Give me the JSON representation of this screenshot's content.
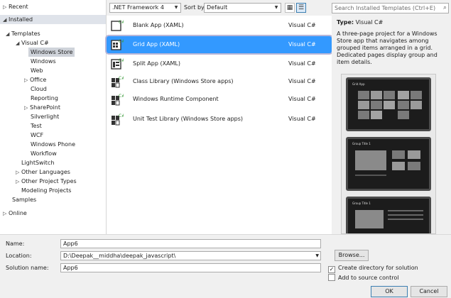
{
  "tree": {
    "recent": "Recent",
    "installed": "Installed",
    "templates": "Templates",
    "visual_csharp": "Visual C#",
    "windows_store": "Windows Store",
    "windows": "Windows",
    "web": "Web",
    "office": "Office",
    "cloud": "Cloud",
    "reporting": "Reporting",
    "sharepoint": "SharePoint",
    "silverlight": "Silverlight",
    "test": "Test",
    "wcf": "WCF",
    "windows_phone": "Windows Phone",
    "workflow": "Workflow",
    "lightswitch": "LightSwitch",
    "other_languages": "Other Languages",
    "other_project_types": "Other Project Types",
    "modeling_projects": "Modeling Projects",
    "samples": "Samples",
    "online": "Online"
  },
  "toolbar": {
    "framework": ".NET Framework 4",
    "sort_label": "Sort by:",
    "sort_value": "Default"
  },
  "templates": [
    {
      "name": "Blank App (XAML)",
      "lang": "Visual C#"
    },
    {
      "name": "Grid App (XAML)",
      "lang": "Visual C#"
    },
    {
      "name": "Split App (XAML)",
      "lang": "Visual C#"
    },
    {
      "name": "Class Library (Windows Store apps)",
      "lang": "Visual C#"
    },
    {
      "name": "Windows Runtime Component",
      "lang": "Visual C#"
    },
    {
      "name": "Unit Test Library (Windows Store apps)",
      "lang": "Visual C#"
    }
  ],
  "details": {
    "search_placeholder": "Search Installed Templates (Ctrl+E)",
    "type_label": "Type:",
    "type_value": "Visual C#",
    "description": "A three-page project for a Windows Store app that navigates among grouped items arranged in a grid. Dedicated pages display group and item details.",
    "preview_titles": [
      "Grid App",
      "Group Title 1",
      "Group Title 1"
    ]
  },
  "form": {
    "name_label": "Name:",
    "name_value": "App6",
    "location_label": "Location:",
    "location_value": "D:\\Deepak__middha\\deepak_javascript\\",
    "solution_label": "Solution name:",
    "solution_value": "App6",
    "browse": "Browse...",
    "create_dir": "Create directory for solution",
    "add_source": "Add to source control",
    "ok": "OK",
    "cancel": "Cancel"
  },
  "colors": {
    "selection": "#3399ff",
    "tree_selection": "#cfd3da"
  }
}
